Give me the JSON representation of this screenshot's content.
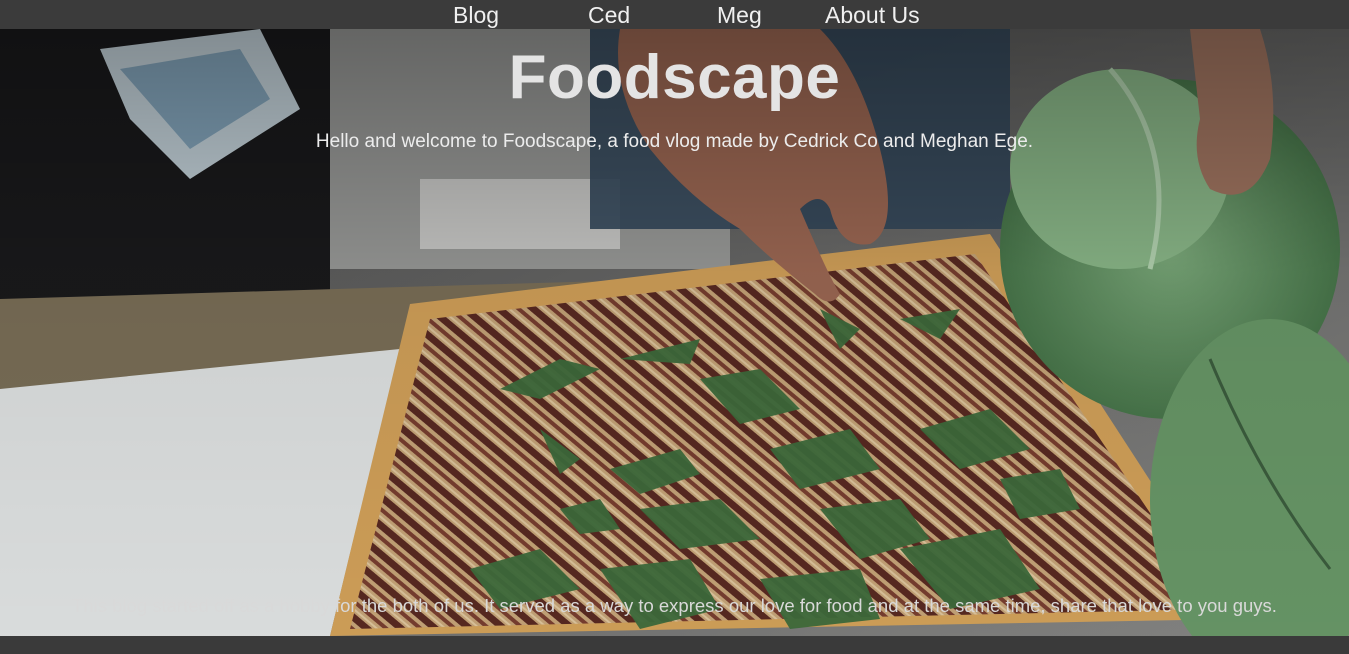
{
  "nav": {
    "items": [
      {
        "label": "Blog"
      },
      {
        "label": "Ced"
      },
      {
        "label": "Meg"
      },
      {
        "label": "About Us"
      }
    ]
  },
  "hero": {
    "title": "Foodscape",
    "tagline": "Hello and welcome to Foodscape, a food vlog made by Cedrick Co and Meghan Ege.",
    "intro": "This blog started off as a hobby for the both of us. It served as a way to express our love for food and at the same time, share that love to you guys."
  }
}
